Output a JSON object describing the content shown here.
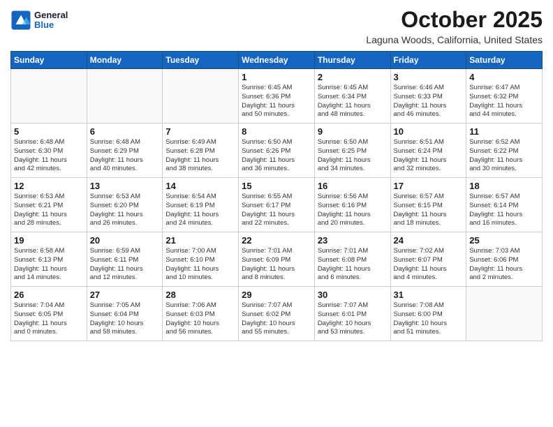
{
  "header": {
    "logo": {
      "general": "General",
      "blue": "Blue"
    },
    "title": "October 2025",
    "location": "Laguna Woods, California, United States"
  },
  "weekdays": [
    "Sunday",
    "Monday",
    "Tuesday",
    "Wednesday",
    "Thursday",
    "Friday",
    "Saturday"
  ],
  "weeks": [
    [
      {
        "day": "",
        "info": ""
      },
      {
        "day": "",
        "info": ""
      },
      {
        "day": "",
        "info": ""
      },
      {
        "day": "1",
        "info": "Sunrise: 6:45 AM\nSunset: 6:36 PM\nDaylight: 11 hours\nand 50 minutes."
      },
      {
        "day": "2",
        "info": "Sunrise: 6:45 AM\nSunset: 6:34 PM\nDaylight: 11 hours\nand 48 minutes."
      },
      {
        "day": "3",
        "info": "Sunrise: 6:46 AM\nSunset: 6:33 PM\nDaylight: 11 hours\nand 46 minutes."
      },
      {
        "day": "4",
        "info": "Sunrise: 6:47 AM\nSunset: 6:32 PM\nDaylight: 11 hours\nand 44 minutes."
      }
    ],
    [
      {
        "day": "5",
        "info": "Sunrise: 6:48 AM\nSunset: 6:30 PM\nDaylight: 11 hours\nand 42 minutes."
      },
      {
        "day": "6",
        "info": "Sunrise: 6:48 AM\nSunset: 6:29 PM\nDaylight: 11 hours\nand 40 minutes."
      },
      {
        "day": "7",
        "info": "Sunrise: 6:49 AM\nSunset: 6:28 PM\nDaylight: 11 hours\nand 38 minutes."
      },
      {
        "day": "8",
        "info": "Sunrise: 6:50 AM\nSunset: 6:26 PM\nDaylight: 11 hours\nand 36 minutes."
      },
      {
        "day": "9",
        "info": "Sunrise: 6:50 AM\nSunset: 6:25 PM\nDaylight: 11 hours\nand 34 minutes."
      },
      {
        "day": "10",
        "info": "Sunrise: 6:51 AM\nSunset: 6:24 PM\nDaylight: 11 hours\nand 32 minutes."
      },
      {
        "day": "11",
        "info": "Sunrise: 6:52 AM\nSunset: 6:22 PM\nDaylight: 11 hours\nand 30 minutes."
      }
    ],
    [
      {
        "day": "12",
        "info": "Sunrise: 6:53 AM\nSunset: 6:21 PM\nDaylight: 11 hours\nand 28 minutes."
      },
      {
        "day": "13",
        "info": "Sunrise: 6:53 AM\nSunset: 6:20 PM\nDaylight: 11 hours\nand 26 minutes."
      },
      {
        "day": "14",
        "info": "Sunrise: 6:54 AM\nSunset: 6:19 PM\nDaylight: 11 hours\nand 24 minutes."
      },
      {
        "day": "15",
        "info": "Sunrise: 6:55 AM\nSunset: 6:17 PM\nDaylight: 11 hours\nand 22 minutes."
      },
      {
        "day": "16",
        "info": "Sunrise: 6:56 AM\nSunset: 6:16 PM\nDaylight: 11 hours\nand 20 minutes."
      },
      {
        "day": "17",
        "info": "Sunrise: 6:57 AM\nSunset: 6:15 PM\nDaylight: 11 hours\nand 18 minutes."
      },
      {
        "day": "18",
        "info": "Sunrise: 6:57 AM\nSunset: 6:14 PM\nDaylight: 11 hours\nand 16 minutes."
      }
    ],
    [
      {
        "day": "19",
        "info": "Sunrise: 6:58 AM\nSunset: 6:13 PM\nDaylight: 11 hours\nand 14 minutes."
      },
      {
        "day": "20",
        "info": "Sunrise: 6:59 AM\nSunset: 6:11 PM\nDaylight: 11 hours\nand 12 minutes."
      },
      {
        "day": "21",
        "info": "Sunrise: 7:00 AM\nSunset: 6:10 PM\nDaylight: 11 hours\nand 10 minutes."
      },
      {
        "day": "22",
        "info": "Sunrise: 7:01 AM\nSunset: 6:09 PM\nDaylight: 11 hours\nand 8 minutes."
      },
      {
        "day": "23",
        "info": "Sunrise: 7:01 AM\nSunset: 6:08 PM\nDaylight: 11 hours\nand 6 minutes."
      },
      {
        "day": "24",
        "info": "Sunrise: 7:02 AM\nSunset: 6:07 PM\nDaylight: 11 hours\nand 4 minutes."
      },
      {
        "day": "25",
        "info": "Sunrise: 7:03 AM\nSunset: 6:06 PM\nDaylight: 11 hours\nand 2 minutes."
      }
    ],
    [
      {
        "day": "26",
        "info": "Sunrise: 7:04 AM\nSunset: 6:05 PM\nDaylight: 11 hours\nand 0 minutes."
      },
      {
        "day": "27",
        "info": "Sunrise: 7:05 AM\nSunset: 6:04 PM\nDaylight: 10 hours\nand 58 minutes."
      },
      {
        "day": "28",
        "info": "Sunrise: 7:06 AM\nSunset: 6:03 PM\nDaylight: 10 hours\nand 56 minutes."
      },
      {
        "day": "29",
        "info": "Sunrise: 7:07 AM\nSunset: 6:02 PM\nDaylight: 10 hours\nand 55 minutes."
      },
      {
        "day": "30",
        "info": "Sunrise: 7:07 AM\nSunset: 6:01 PM\nDaylight: 10 hours\nand 53 minutes."
      },
      {
        "day": "31",
        "info": "Sunrise: 7:08 AM\nSunset: 6:00 PM\nDaylight: 10 hours\nand 51 minutes."
      },
      {
        "day": "",
        "info": ""
      }
    ]
  ]
}
